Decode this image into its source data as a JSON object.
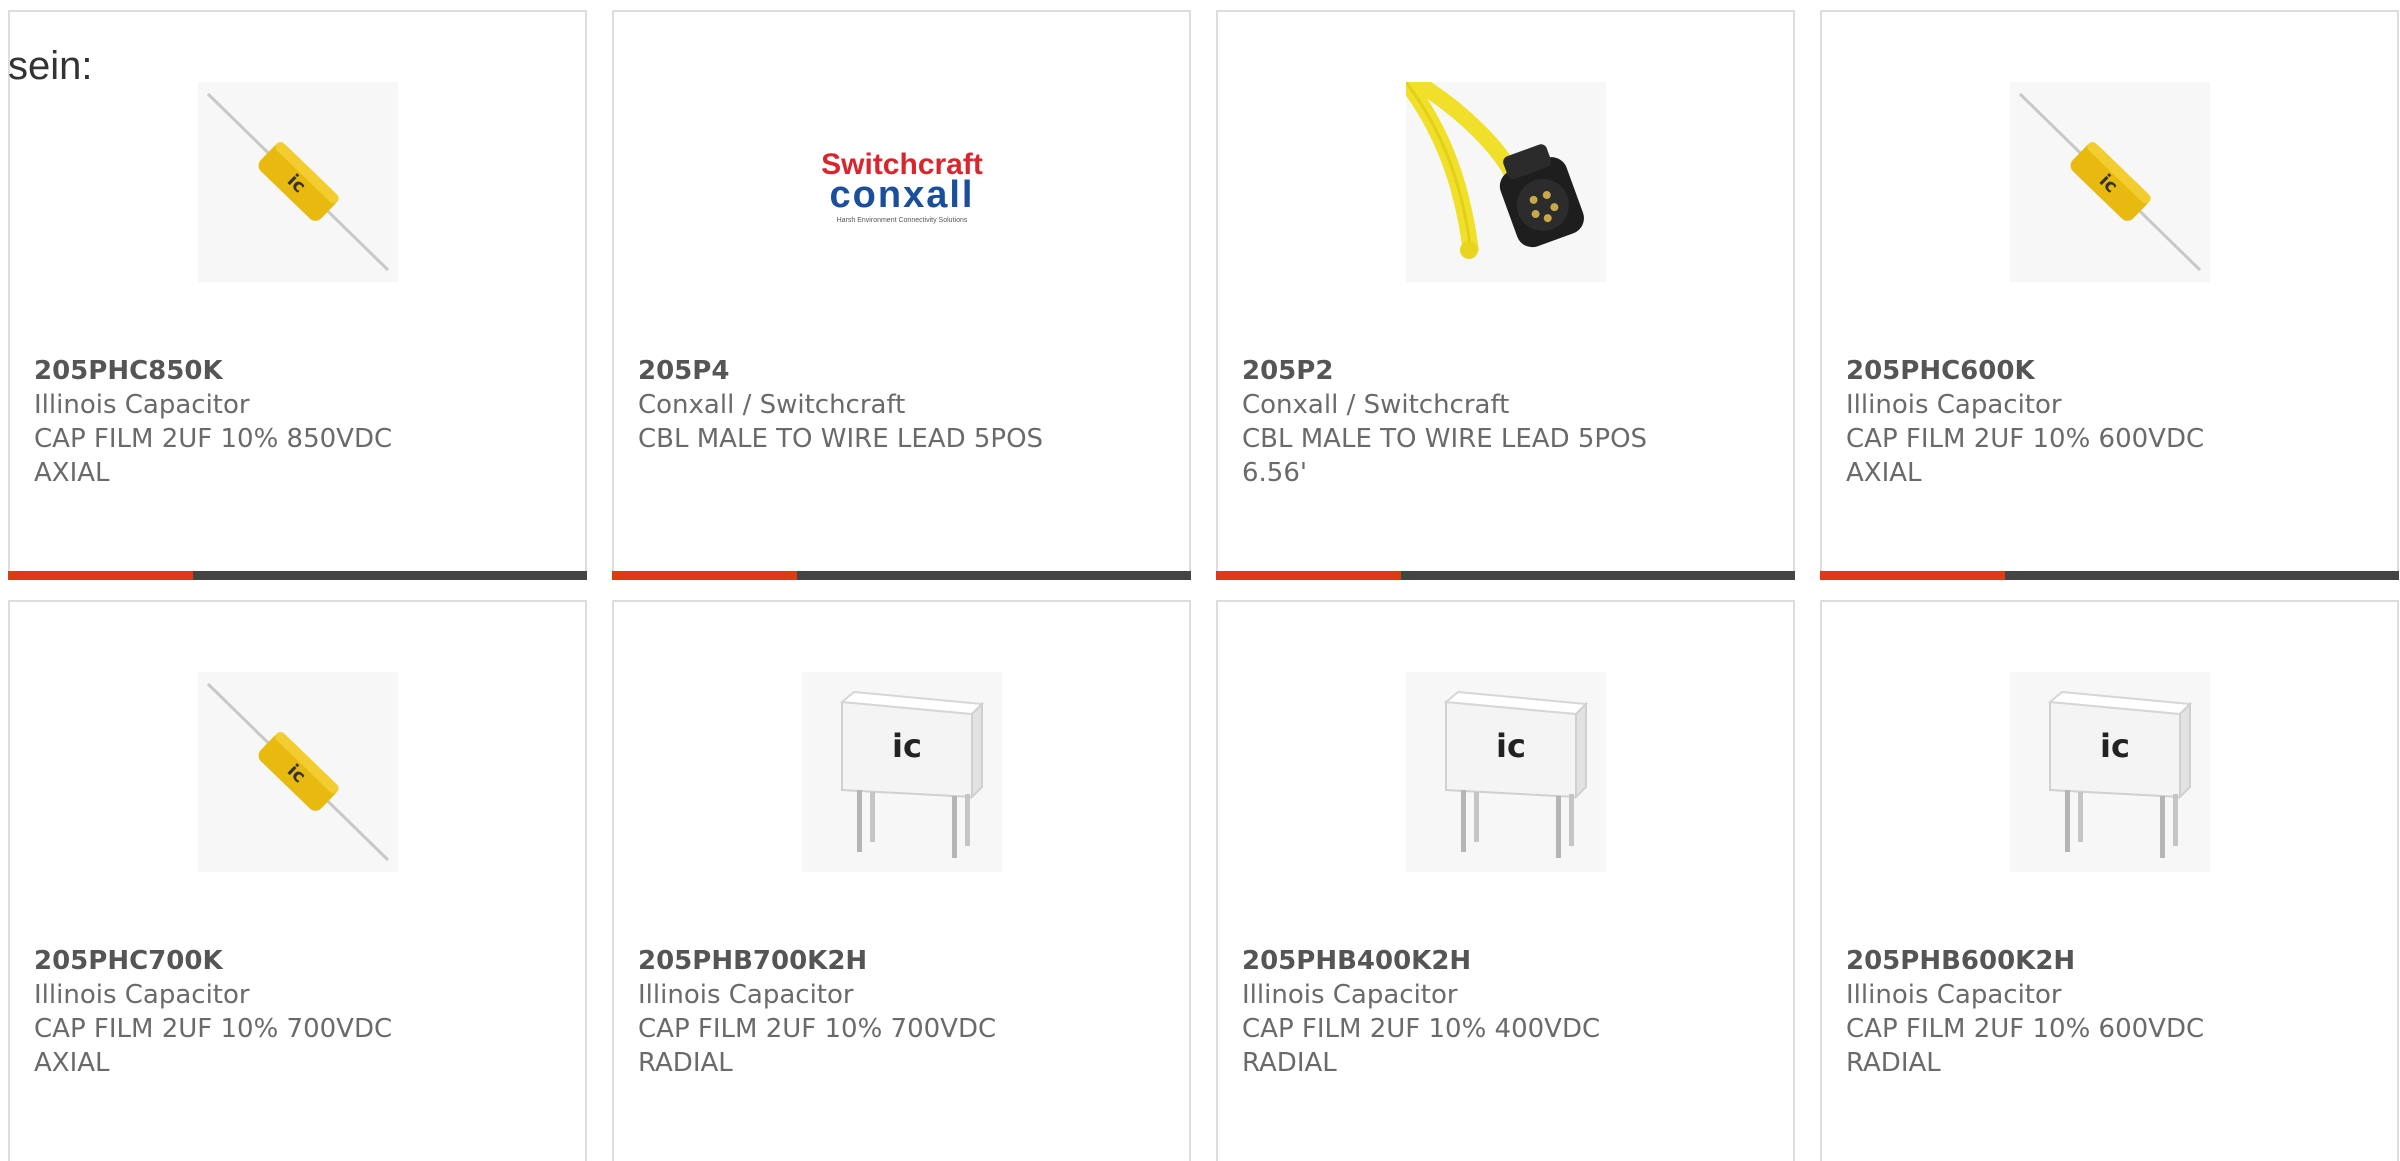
{
  "intro_text": "sein:",
  "colors": {
    "accent": "#e03a12",
    "bar_track": "#444444",
    "card_border": "#dddddd",
    "text": "#6a6a6a",
    "part_number": "#555555"
  },
  "products": [
    {
      "part_number": "205PHC850K",
      "manufacturer": "Illinois Capacitor",
      "description": "CAP FILM 2UF 10% 850VDC AXIAL",
      "image": "axial-capacitor-icon",
      "progress": 0.32
    },
    {
      "part_number": "205P4",
      "manufacturer": "Conxall / Switchcraft",
      "description": "CBL MALE TO WIRE LEAD 5POS",
      "image": "switchcraft-conxall-logo",
      "logo_text": {
        "line1": "Switchcraft",
        "line2": "conxall",
        "tagline": "Harsh Environment Connectivity Solutions"
      },
      "progress": 0.32
    },
    {
      "part_number": "205P2",
      "manufacturer": "Conxall / Switchcraft",
      "description": "CBL MALE TO WIRE LEAD 5POS 6.56'",
      "image": "cable-connector-icon",
      "progress": 0.32
    },
    {
      "part_number": "205PHC600K",
      "manufacturer": "Illinois Capacitor",
      "description": "CAP FILM 2UF 10% 600VDC AXIAL",
      "image": "axial-capacitor-icon",
      "progress": 0.32
    },
    {
      "part_number": "205PHC700K",
      "manufacturer": "Illinois Capacitor",
      "description": "CAP FILM 2UF 10% 700VDC AXIAL",
      "image": "axial-capacitor-icon"
    },
    {
      "part_number": "205PHB700K2H",
      "manufacturer": "Illinois Capacitor",
      "description": "CAP FILM 2UF 10% 700VDC RADIAL",
      "image": "radial-capacitor-icon"
    },
    {
      "part_number": "205PHB400K2H",
      "manufacturer": "Illinois Capacitor",
      "description": "CAP FILM 2UF 10% 400VDC RADIAL",
      "image": "radial-capacitor-icon"
    },
    {
      "part_number": "205PHB600K2H",
      "manufacturer": "Illinois Capacitor",
      "description": "CAP FILM 2UF 10% 600VDC RADIAL",
      "image": "radial-capacitor-icon"
    }
  ]
}
